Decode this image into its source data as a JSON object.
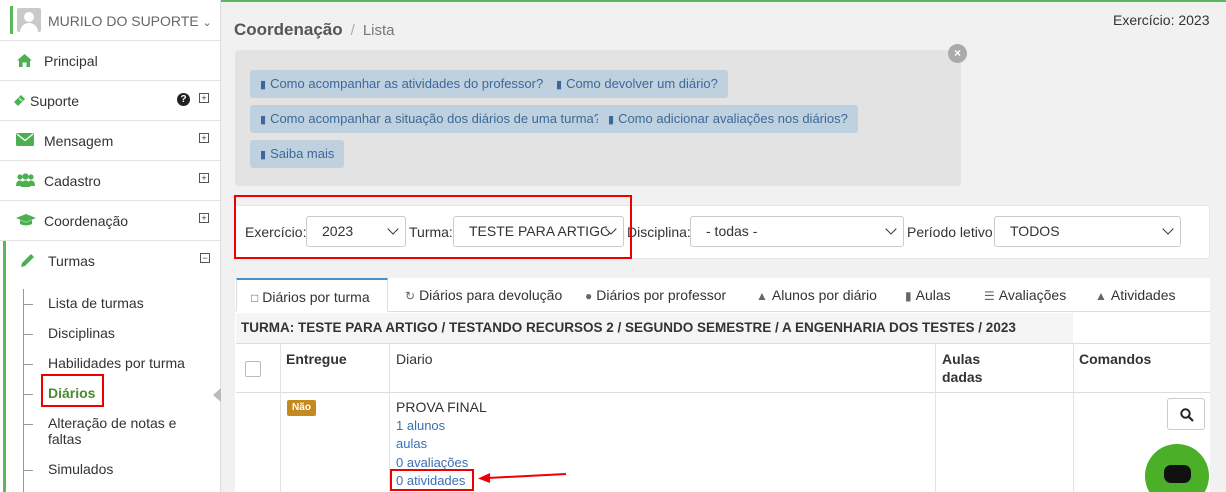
{
  "sidebar": {
    "user_name": "MURILO DO SUPORTE",
    "items": [
      {
        "label": "Principal",
        "icon": "home-icon"
      },
      {
        "label": "Suporte",
        "icon": "ticket-icon"
      },
      {
        "label": "Mensagem",
        "icon": "envelope-icon"
      },
      {
        "label": "Cadastro",
        "icon": "users-icon"
      },
      {
        "label": "Coordenação",
        "icon": "graduation-cap-icon"
      },
      {
        "label": "Turmas",
        "icon": "pencil-icon"
      }
    ],
    "sub_items": [
      "Lista de turmas",
      "Disciplinas",
      "Habilidades por turma",
      "Diários",
      "Alteração de notas e faltas",
      "Simulados"
    ],
    "active_sub_item": "Diários"
  },
  "header": {
    "breadcrumb_main": "Coordenação",
    "breadcrumb_sep": "/",
    "breadcrumb_sub": "Lista",
    "exercicio": "Exercício: 2023"
  },
  "help": {
    "close": "×",
    "buttons": [
      "Como acompanhar as atividades do professor?",
      "Como devolver um diário?",
      "Como acompanhar a situação dos diários de uma turma?",
      "Como adicionar avaliações nos diários?",
      "Saiba mais"
    ]
  },
  "filters": {
    "exercicio_label": "Exercício:",
    "exercicio_value": "2023",
    "turma_label": "Turma:",
    "turma_value": "TESTE PARA ARTIGO",
    "disciplina_label": "Disciplina:",
    "disciplina_value": "- todas -",
    "periodo_label": "Período letivo:",
    "periodo_value": "TODOS"
  },
  "tabs": [
    {
      "label": "Diários por turma",
      "icon": "bookmark-icon",
      "active": true
    },
    {
      "label": "Diários para devolução",
      "icon": "refresh-icon"
    },
    {
      "label": "Diários por professor",
      "icon": "users-icon"
    },
    {
      "label": "Alunos por diário",
      "icon": "graduation-cap-icon"
    },
    {
      "label": "Aulas",
      "icon": "book-icon"
    },
    {
      "label": "Avaliações",
      "icon": "list-icon"
    },
    {
      "label": "Atividades",
      "icon": "bell-icon"
    }
  ],
  "table": {
    "turma_header": "TURMA: TESTE PARA ARTIGO / TESTANDO RECURSOS 2 / SEGUNDO SEMESTRE / A ENGENHARIA DOS TESTES / 2023",
    "columns": [
      "Entregue",
      "Diario",
      "Aulas dadas",
      "Comandos"
    ],
    "rows": [
      {
        "entregue": "Não",
        "diario": "PROVA FINAL",
        "links": [
          "1 alunos",
          "aulas",
          "0 avaliações",
          "0 atividades"
        ]
      }
    ]
  },
  "colors": {
    "accent_green": "#5cb85c",
    "highlight_red": "#e00000",
    "badge": "#c58a1e",
    "link": "#3a6fb0"
  }
}
